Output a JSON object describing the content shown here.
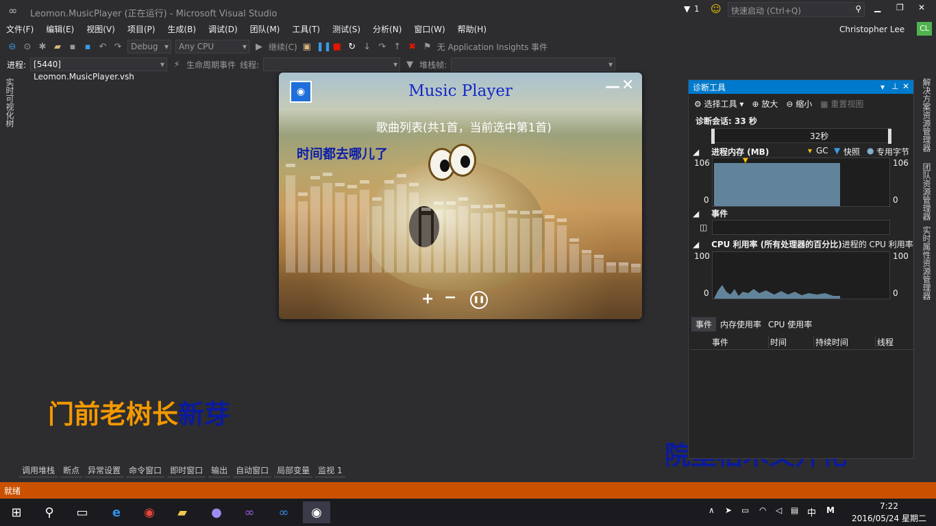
{
  "title_bar": {
    "title": "Leomon.MusicPlayer (正在运行) - Microsoft Visual Studio",
    "filter_count": "1",
    "quick_launch_placeholder": "快速启动 (Ctrl+Q)"
  },
  "menu": [
    "文件(F)",
    "编辑(E)",
    "视图(V)",
    "项目(P)",
    "生成(B)",
    "调试(D)",
    "团队(M)",
    "工具(T)",
    "测试(S)",
    "分析(N)",
    "窗口(W)",
    "帮助(H)"
  ],
  "user": {
    "name": "Christopher Lee",
    "initials": "CL"
  },
  "toolbar": {
    "config": "Debug",
    "platform": "Any CPU",
    "continue_label": "继续(C)",
    "insights_label": "无 Application Insights 事件"
  },
  "toolbar2": {
    "process_label": "进程:",
    "process_value": "[5440] Leomon.MusicPlayer.vsh",
    "lifecycle_label": "生命周期事件",
    "thread_label": "线程:",
    "stackframe_label": "堆栈帧:"
  },
  "left_strip": {
    "label": "实时可视化树"
  },
  "right_strip": [
    "解决方案资源管理器",
    "团队资源管理器",
    "实时属性资源管理器"
  ],
  "player": {
    "title": "Music Player",
    "playlist_info": "歌曲列表(共1首，当前选中第1首)",
    "song_title": "时间都去哪儿了",
    "bars": [
      0.85,
      0.62,
      0.75,
      0.78,
      0.7,
      0.68,
      0.72,
      0.58,
      0.72,
      0.77,
      0.7,
      0.5,
      0.55,
      0.55,
      0.58,
      0.52,
      0.52,
      0.53,
      0.48,
      0.47,
      0.48,
      0.44,
      0.41,
      0.25,
      0.16,
      0.12,
      0.06,
      0.06,
      0.05
    ]
  },
  "lyrics": {
    "left_sung": "门前老树长",
    "left_unsung": "新芽",
    "right": "院里枯木又开花"
  },
  "diagnostics": {
    "title": "诊断工具",
    "tools_label": "选择工具",
    "zoom_in": "放大",
    "zoom_out": "缩小",
    "reset_view": "重置视图",
    "session_label": "诊断会话: 33 秒",
    "time_marker": "32秒",
    "memory_label": "进程内存 (MB)",
    "legend_gc": "GC",
    "legend_snapshot": "快照",
    "legend_private": "专用字节",
    "memory_max": "106",
    "memory_min": "0",
    "events_label": "事件",
    "cpu_label": "CPU 利用率 (所有处理器的百分比)",
    "cpu_label_right": "进程的 CPU 利用率",
    "cpu_max": "100",
    "cpu_min": "0",
    "tabs": [
      "事件",
      "内存使用率",
      "CPU 使用率"
    ],
    "columns": [
      "事件",
      "时间",
      "持续时间",
      "线程"
    ]
  },
  "bottom_tabs": [
    "调用堆栈",
    "断点",
    "异常设置",
    "命令窗口",
    "即时窗口",
    "输出",
    "自动窗口",
    "局部变量",
    "监视 1"
  ],
  "status": "就绪",
  "taskbar": {
    "time": "7:22",
    "date": "2016/05/24 星期二",
    "ime": "中"
  },
  "colors": {
    "accent": "#007acc",
    "status_bar": "#ca5100",
    "lyric_sung": "#f39800",
    "lyric_unsung": "#0a1a9e"
  }
}
